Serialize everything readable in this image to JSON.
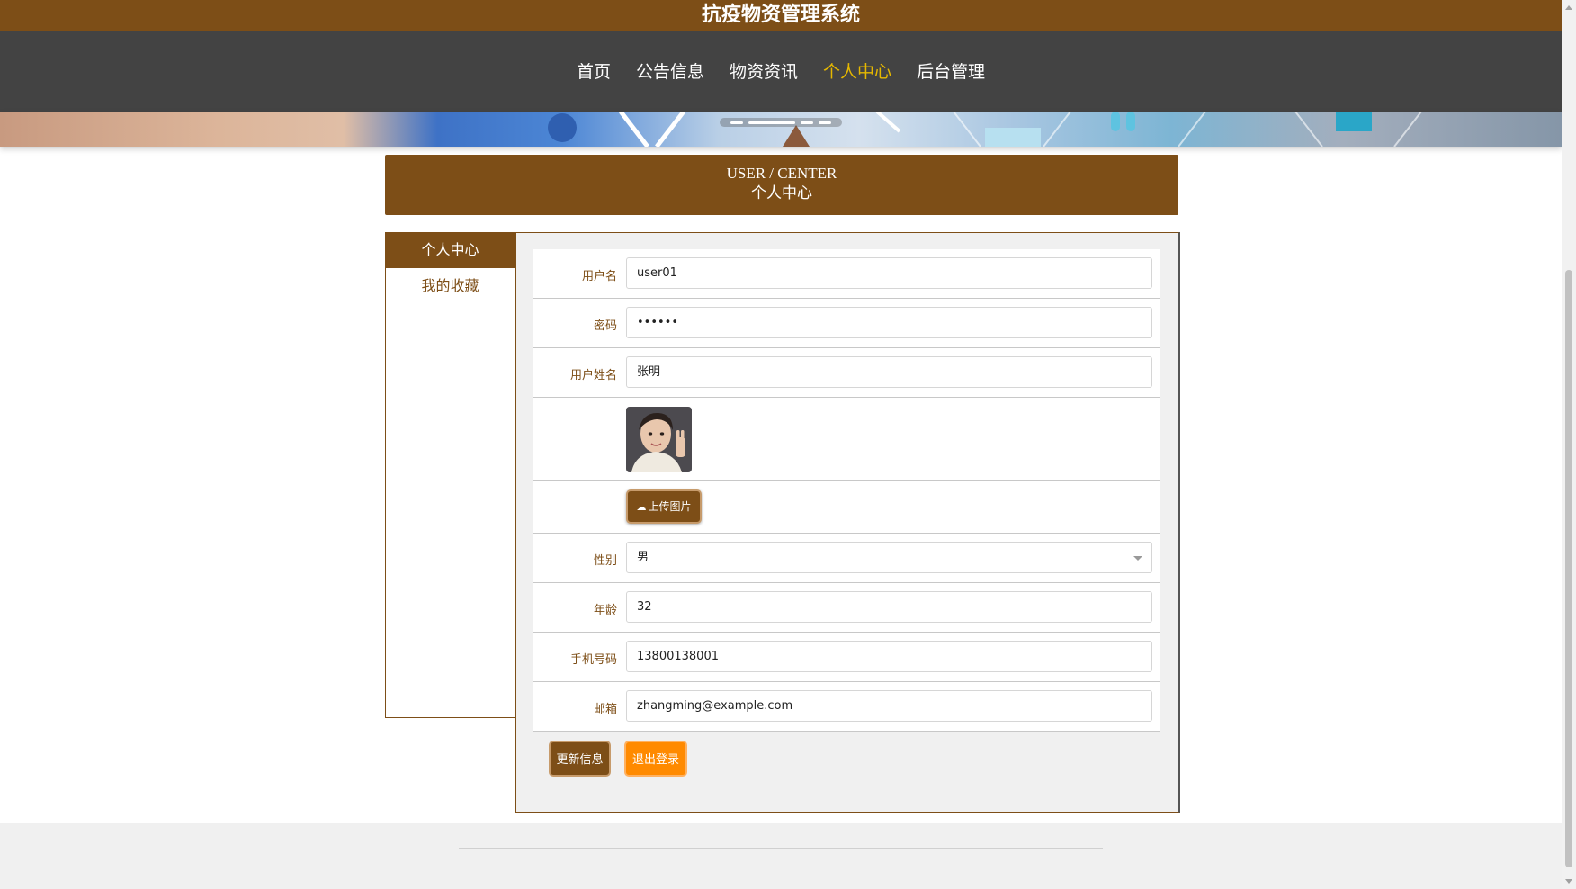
{
  "app": {
    "title": "抗疫物资管理系统"
  },
  "nav": {
    "items": [
      {
        "label": "首页",
        "active": false
      },
      {
        "label": "公告信息",
        "active": false
      },
      {
        "label": "物资资讯",
        "active": false
      },
      {
        "label": "个人中心",
        "active": true
      },
      {
        "label": "后台管理",
        "active": false
      }
    ]
  },
  "section": {
    "title_en": "USER / CENTER",
    "title_cn": "个人中心"
  },
  "sidebar": {
    "items": [
      {
        "label": "个人中心",
        "active": true
      },
      {
        "label": "我的收藏",
        "active": false
      }
    ]
  },
  "form": {
    "username": {
      "label": "用户名",
      "value": "user01"
    },
    "password": {
      "label": "密码",
      "value": "••••••"
    },
    "realname": {
      "label": "用户姓名",
      "value": "张明"
    },
    "avatar": {
      "description": "avatar-photo"
    },
    "upload": {
      "label": "上传图片",
      "icon": "cloud-upload-icon"
    },
    "gender": {
      "label": "性别",
      "value": "男"
    },
    "age": {
      "label": "年龄",
      "value": "32"
    },
    "phone": {
      "label": "手机号码",
      "value": "13800138001"
    },
    "email": {
      "label": "邮箱",
      "value": "zhangming@example.com"
    }
  },
  "actions": {
    "update_label": "更新信息",
    "logout_label": "退出登录"
  },
  "colors": {
    "primary": "#7d4e17",
    "nav_bg": "#434343",
    "nav_active": "#e6b800",
    "logout": "#ff8a00"
  }
}
